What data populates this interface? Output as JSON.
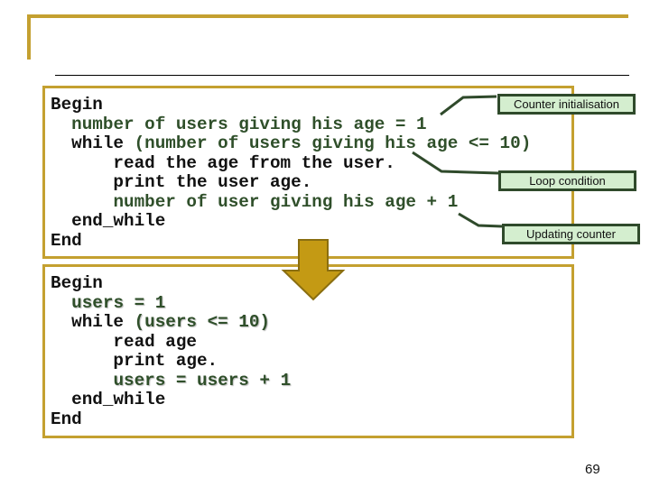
{
  "slide": {
    "page_number": "69",
    "colors": {
      "accent_gold": "#c4a030",
      "arrow_fill": "#c49a14",
      "arrow_stroke": "#8a6e10",
      "code_green": "#2f4f2a",
      "callout_fill": "#d4eecf",
      "callout_border": "#2f4a2b"
    }
  },
  "top_block": {
    "lines": [
      {
        "plain": "Begin",
        "green": ""
      },
      {
        "plain": "  ",
        "green": "number of users giving his age = 1"
      },
      {
        "plain": "  while ",
        "green": "(number of users giving his age <= 10)"
      },
      {
        "plain": "      read the age from the user.",
        "green": ""
      },
      {
        "plain": "      print the user age.",
        "green": ""
      },
      {
        "plain": "      ",
        "green": "number of user giving his age + 1"
      },
      {
        "plain": "  end_while",
        "green": ""
      },
      {
        "plain": "End",
        "green": ""
      }
    ]
  },
  "callouts": {
    "init": "Counter initialisation",
    "loop": "Loop condition",
    "update": "Updating counter"
  },
  "arrow": {
    "icon": "down-arrow-icon"
  },
  "bottom_block": {
    "lines": [
      {
        "plain": "Begin",
        "green": ""
      },
      {
        "plain": "  ",
        "green": "users = 1"
      },
      {
        "plain": "  while ",
        "green": "(users <= 10)"
      },
      {
        "plain": "      read age",
        "green": ""
      },
      {
        "plain": "      print age.",
        "green": ""
      },
      {
        "plain": "      ",
        "green": "users = users + 1"
      },
      {
        "plain": "  end_while",
        "green": ""
      },
      {
        "plain": "End",
        "green": ""
      }
    ]
  }
}
